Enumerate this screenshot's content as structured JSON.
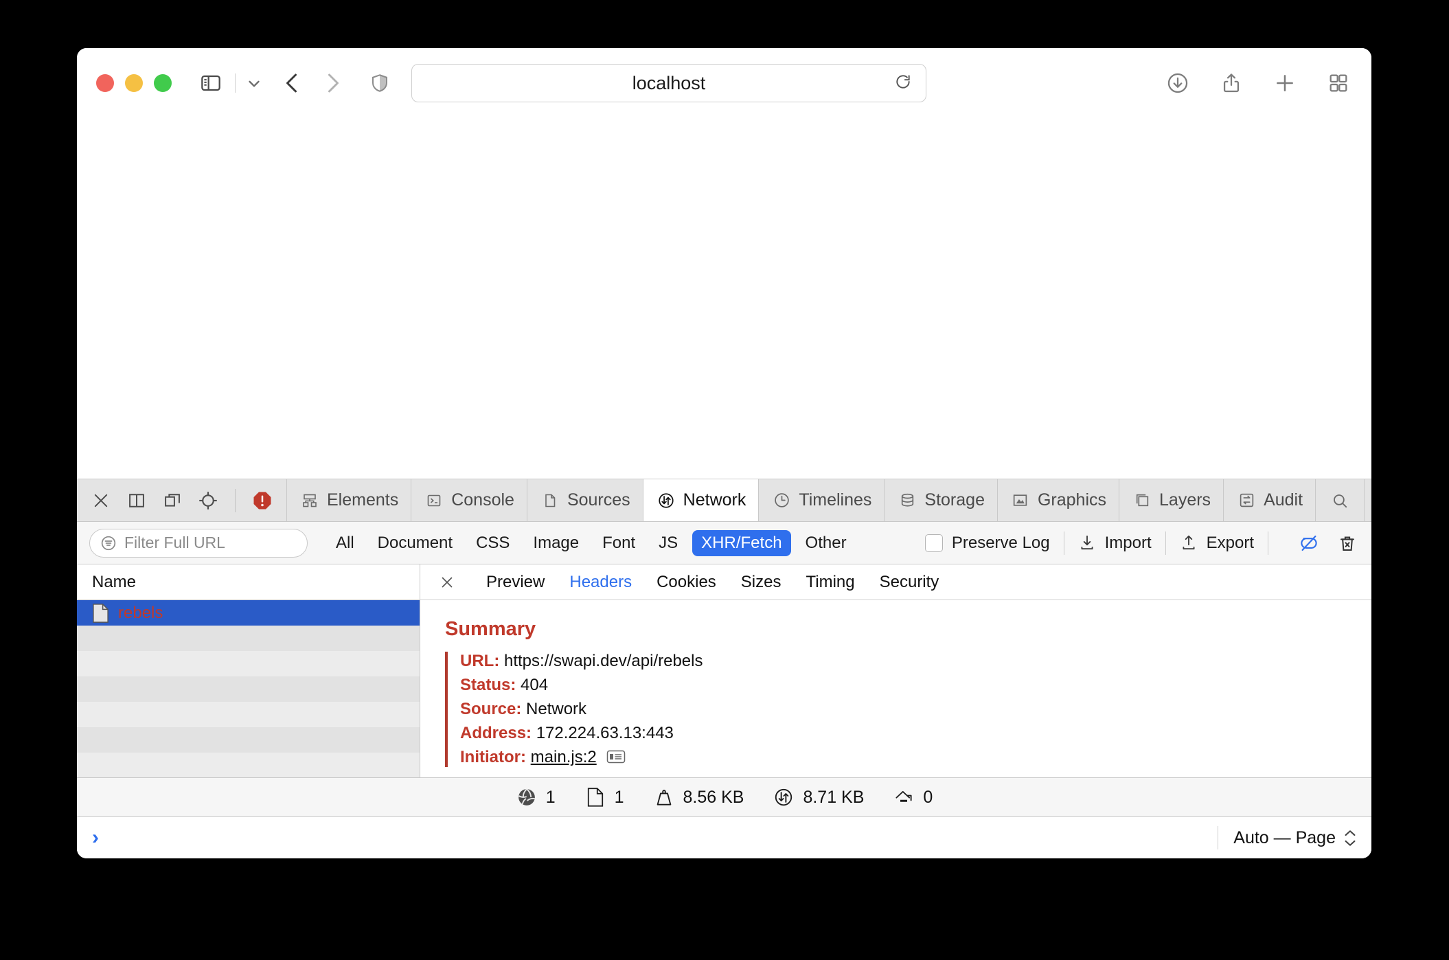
{
  "browser": {
    "url_value": "localhost",
    "traffic_lights": [
      "close-red",
      "minimize-yellow",
      "zoom-green"
    ],
    "icons": {
      "sidebar": "sidebar-toggle-icon",
      "chevron": "chevron-down-icon",
      "back": "back-arrow-icon",
      "forward": "forward-arrow-icon",
      "shield": "shield-icon",
      "reload": "reload-icon",
      "downloads": "downloads-icon",
      "share": "share-icon",
      "newtab": "plus-icon",
      "taboverview": "tab-overview-icon"
    }
  },
  "inspector": {
    "toolbar_icons": [
      "close-icon",
      "dock-bottom-icon",
      "dock-side-icon",
      "inspect-element-icon",
      "error-badge-icon"
    ],
    "tabs": [
      {
        "label": "Elements",
        "icon": "elements-icon",
        "active": false
      },
      {
        "label": "Console",
        "icon": "console-icon",
        "active": false
      },
      {
        "label": "Sources",
        "icon": "sources-icon",
        "active": false
      },
      {
        "label": "Network",
        "icon": "network-icon",
        "active": true
      },
      {
        "label": "Timelines",
        "icon": "timelines-icon",
        "active": false
      },
      {
        "label": "Storage",
        "icon": "storage-icon",
        "active": false
      },
      {
        "label": "Graphics",
        "icon": "graphics-icon",
        "active": false
      },
      {
        "label": "Layers",
        "icon": "layers-icon",
        "active": false
      },
      {
        "label": "Audit",
        "icon": "audit-icon",
        "active": false
      }
    ],
    "tab_end_icons": [
      "search-icon",
      "gear-icon"
    ],
    "accent_color": "#2f6fed",
    "error_color": "#c0392b"
  },
  "filterbar": {
    "filter_placeholder": "Filter Full URL",
    "filter_value": "",
    "types": [
      {
        "label": "All",
        "active": false
      },
      {
        "label": "Document",
        "active": false
      },
      {
        "label": "CSS",
        "active": false
      },
      {
        "label": "Image",
        "active": false
      },
      {
        "label": "Font",
        "active": false
      },
      {
        "label": "JS",
        "active": false
      },
      {
        "label": "XHR/Fetch",
        "active": true
      },
      {
        "label": "Other",
        "active": false
      }
    ],
    "preserve_log_label": "Preserve Log",
    "preserve_log_checked": false,
    "import_label": "Import",
    "export_label": "Export",
    "right_icons": [
      "disable-network-throttle-icon",
      "clear-network-items-icon"
    ]
  },
  "resource_list": {
    "column_header": "Name",
    "rows": [
      {
        "name": "rebels",
        "icon": "document-icon",
        "selected": true,
        "error": true
      }
    ],
    "empty_row_count": 6
  },
  "detail": {
    "tabs": [
      {
        "label": "Preview",
        "active": false
      },
      {
        "label": "Headers",
        "active": true
      },
      {
        "label": "Cookies",
        "active": false
      },
      {
        "label": "Sizes",
        "active": false
      },
      {
        "label": "Timing",
        "active": false
      },
      {
        "label": "Security",
        "active": false
      }
    ],
    "close_icon": "close-icon",
    "summary_title": "Summary",
    "fields": [
      {
        "key": "URL:",
        "value": "https://swapi.dev/api/rebels",
        "link": false
      },
      {
        "key": "Status:",
        "value": "404",
        "link": false
      },
      {
        "key": "Source:",
        "value": "Network",
        "link": false
      },
      {
        "key": "Address:",
        "value": "172.224.63.13:443",
        "link": false
      },
      {
        "key": "Initiator:",
        "value": "main.js:2",
        "link": true,
        "badge": "stack-trace-icon"
      }
    ]
  },
  "statusbar": {
    "stats": [
      {
        "icon": "globe-icon",
        "value": "1"
      },
      {
        "icon": "document-icon",
        "value": "1"
      },
      {
        "icon": "weight-icon",
        "value": "8.56 KB"
      },
      {
        "icon": "transfer-icon",
        "value": "8.71 KB"
      },
      {
        "icon": "load-icon",
        "value": "0"
      }
    ]
  },
  "console": {
    "prompt": "›",
    "context_label": "Auto — Page"
  }
}
